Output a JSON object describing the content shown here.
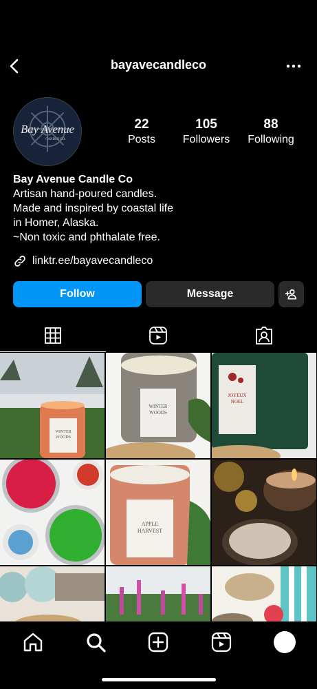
{
  "header": {
    "username": "bayavecandleco",
    "back_icon": "chevron-left-icon",
    "more_icon": "more-horizontal-icon"
  },
  "profile": {
    "avatar_text": "Bay Avenue",
    "avatar_subtext": "CANDLE CO.",
    "stats": {
      "posts_count": "22",
      "posts_label": "Posts",
      "followers_count": "105",
      "followers_label": "Followers",
      "following_count": "88",
      "following_label": "Following"
    },
    "display_name": "Bay Avenue Candle Co",
    "bio_lines": [
      "Artisan hand-poured candles.",
      "Made and inspired by coastal life",
      "in Homer, Alaska.",
      "~Non toxic and phthalate free."
    ],
    "link": "linktr.ee/bayavecandleco"
  },
  "actions": {
    "follow_label": "Follow",
    "message_label": "Message",
    "add_user_icon": "add-user-icon"
  },
  "tabs": [
    {
      "icon": "grid-icon",
      "active": true
    },
    {
      "icon": "reels-icon",
      "active": false
    },
    {
      "icon": "tagged-icon",
      "active": false
    }
  ],
  "posts": [
    {
      "label_line1": "WINTER",
      "label_line2": "WOODS",
      "theme": "snowy-orange-candle"
    },
    {
      "label_line1": "WINTER",
      "label_line2": "WOODS",
      "theme": "grey-candle"
    },
    {
      "label_line1": "JOYEUX",
      "label_line2": "NOEL",
      "theme": "green-candle"
    },
    {
      "label_line1": "",
      "label_line2": "",
      "theme": "red-green-tins"
    },
    {
      "label_line1": "APPLE",
      "label_line2": "HARVEST",
      "theme": "orange-candle"
    },
    {
      "label_line1": "",
      "label_line2": "",
      "theme": "dark-candle"
    },
    {
      "label_line1": "",
      "label_line2": "",
      "theme": "glass-floats"
    },
    {
      "label_line1": "",
      "label_line2": "",
      "theme": "fireweed"
    },
    {
      "label_line1": "",
      "label_line2": "",
      "theme": "tea-set"
    }
  ],
  "colors": {
    "accent": "#0095f6",
    "secondary_button": "#2a2a2a",
    "background": "#000000"
  },
  "bottom_nav": [
    {
      "icon": "home-icon"
    },
    {
      "icon": "search-icon"
    },
    {
      "icon": "create-icon"
    },
    {
      "icon": "reels-icon"
    },
    {
      "icon": "profile-avatar-icon"
    }
  ]
}
